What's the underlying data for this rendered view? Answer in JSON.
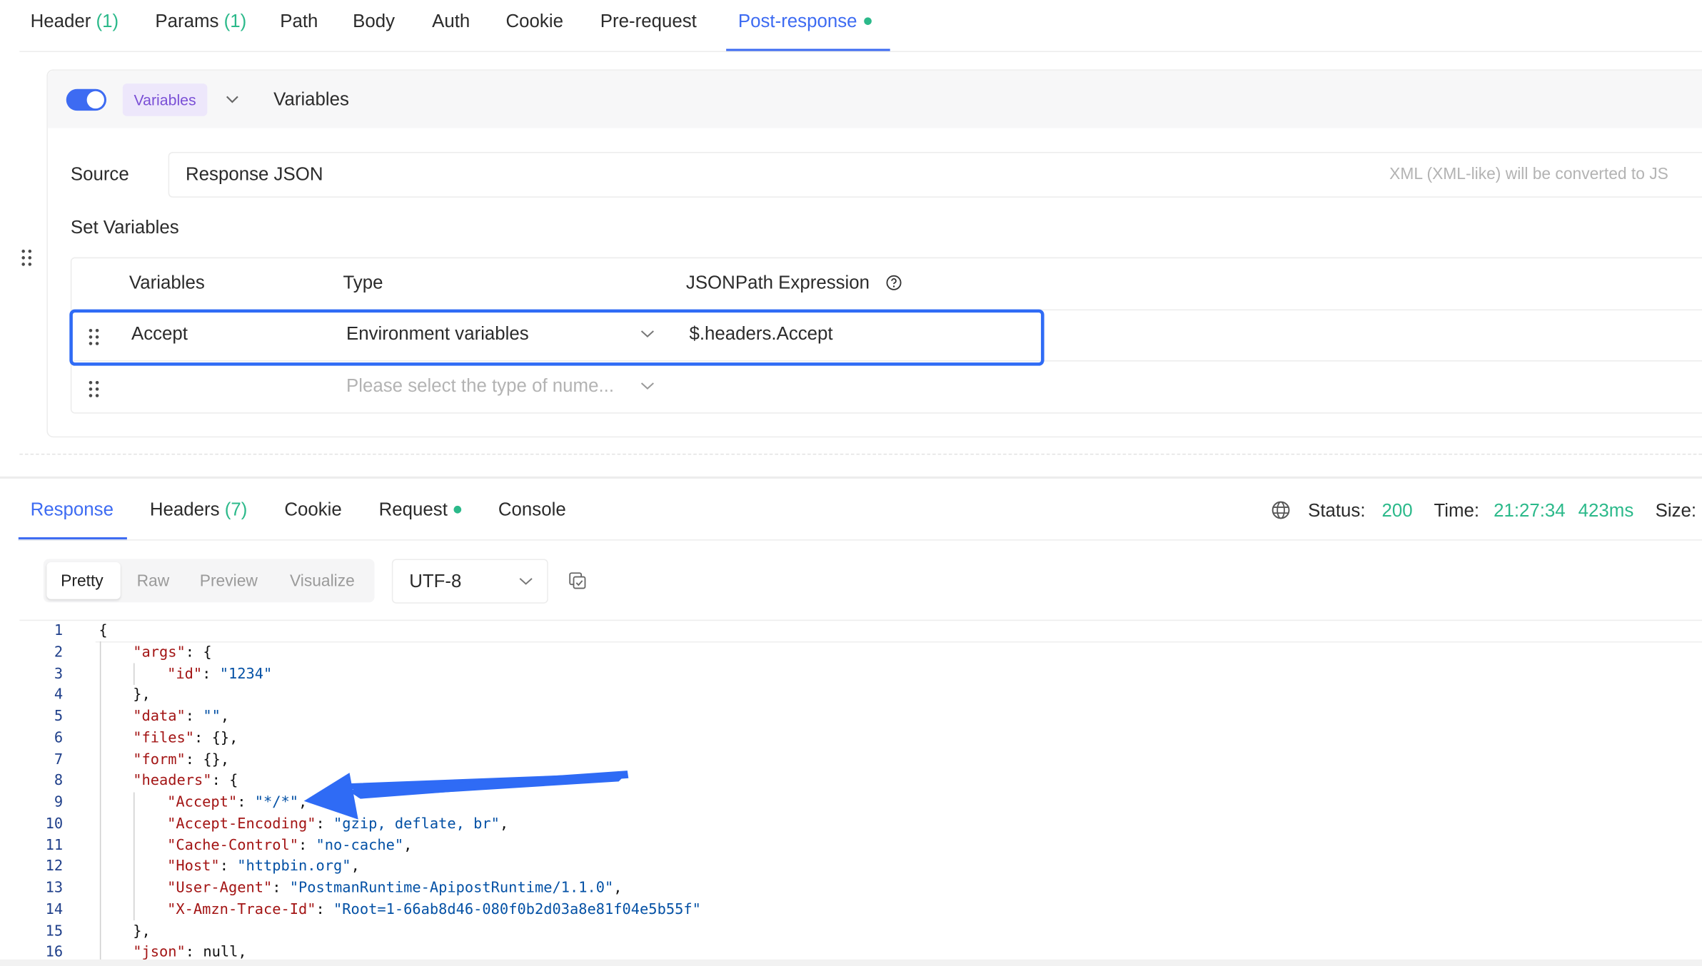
{
  "request_tabs": [
    {
      "label": "Header",
      "count": "(1)"
    },
    {
      "label": "Params",
      "count": "(1)"
    },
    {
      "label": "Path"
    },
    {
      "label": "Body"
    },
    {
      "label": "Auth"
    },
    {
      "label": "Cookie"
    },
    {
      "label": "Pre-request"
    },
    {
      "label": "Post-response",
      "active": true
    }
  ],
  "processor": {
    "enabled": true,
    "tag": "Variables",
    "title": "Variables",
    "source_label": "Source",
    "source_value": "Response JSON",
    "source_hint": "XML (XML-like) will be converted to JS",
    "set_vars_label": "Set Variables",
    "columns": [
      "Variables",
      "Type",
      "JSONPath Expression"
    ],
    "rows": [
      {
        "variable": "Accept",
        "type": "Environment variables",
        "expression": "$.headers.Accept"
      }
    ],
    "empty_type_placeholder": "Please select the type of nume..."
  },
  "response_tabs": [
    {
      "label": "Response",
      "active": true
    },
    {
      "label": "Headers",
      "count": "(7)"
    },
    {
      "label": "Cookie"
    },
    {
      "label": "Request"
    },
    {
      "label": "Console"
    }
  ],
  "status": {
    "status_label": "Status:",
    "status_value": "200",
    "time_label": "Time:",
    "time_value": "21:27:34",
    "duration": "423ms",
    "size_label": "Size:"
  },
  "view_modes": [
    "Pretty",
    "Raw",
    "Preview",
    "Visualize"
  ],
  "encoding": "UTF-8",
  "code_lines": [
    "{",
    "\"args\": {",
    "\"id\": \"1234\"",
    "},",
    "\"data\": \"\",",
    "\"files\": {},",
    "\"form\": {},",
    "\"headers\": {",
    "\"Accept\": \"*/*\",",
    "\"Accept-Encoding\": \"gzip, deflate, br\",",
    "\"Cache-Control\": \"no-cache\",",
    "\"Host\": \"httpbin.org\",",
    "\"User-Agent\": \"PostmanRuntime-ApipostRuntime/1.1.0\",",
    "\"X-Amzn-Trace-Id\": \"Root=1-66ab8d46-080f0b2d03a8e81f04e5b55f\"",
    "},",
    "\"json\": null,"
  ],
  "colors": {
    "accent": "#3d6bf2",
    "success": "#2bb98a",
    "highlight": "#2f6bf5",
    "tag_bg": "#ede7fb",
    "tag_fg": "#7a4fd6"
  }
}
